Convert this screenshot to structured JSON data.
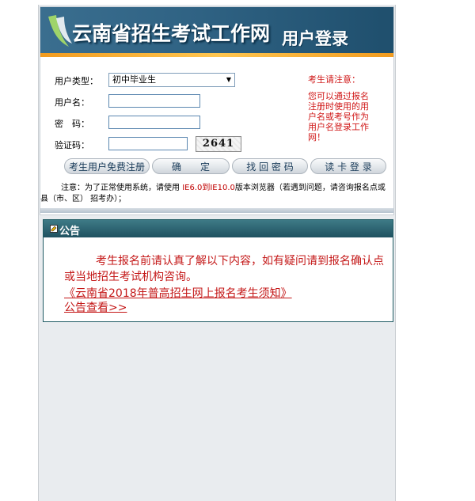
{
  "banner": {
    "title": "云南省招生考试工作网",
    "subtitle": "用户登录"
  },
  "form": {
    "user_type_label": "用户类型：",
    "user_type_value": "初中毕业生",
    "username_label": "用户名：",
    "username_value": "",
    "password_label": "密　码：",
    "password_value": "",
    "captcha_label": "验证码：",
    "captcha_value": "",
    "captcha_text": "2641"
  },
  "notice": {
    "title": "考生请注意：",
    "body": "您可以通过报名注册时使用的用户名或考号作为用户名登录工作网！"
  },
  "buttons": {
    "register": "考生用户免费注册",
    "confirm": "确　　定",
    "recover": "找 回 密 码",
    "card_login": "读 卡 登 录"
  },
  "note": {
    "prefix": "注意：为了正常使用系统，请使用 ",
    "highlight": "IE6.0到IE10.0",
    "suffix": "版本浏览器（若遇到问题，请咨询报名点或县（市、区） 招考办）；"
  },
  "announcement": {
    "header": "公告",
    "text": "考生报名前请认真了解以下内容，如有疑问请到报名确认点或当地招生考试机构咨询。",
    "link1": "《云南省2018年普高招生网上报名考生须知》",
    "link2": "公告查看>>"
  },
  "colors": {
    "banner": "#2f6283",
    "accent_orange": "#f19b1f",
    "notice_red": "#d01818",
    "panel_teal": "#1f5160"
  }
}
